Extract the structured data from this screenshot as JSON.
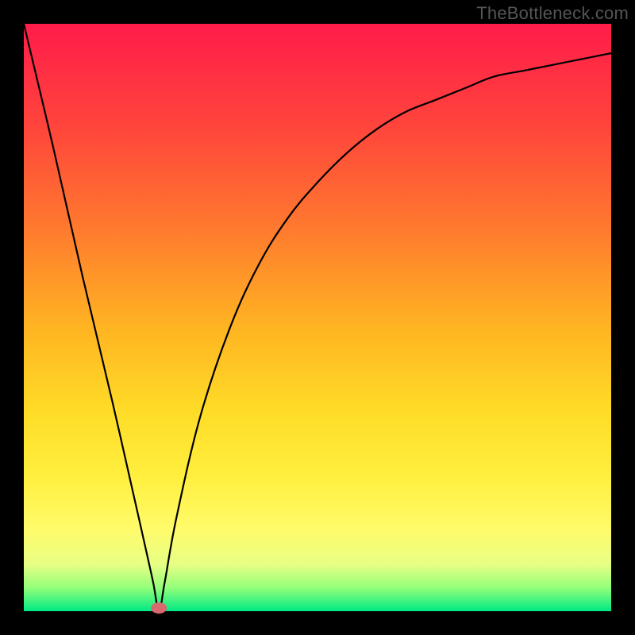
{
  "attribution": "TheBottleneck.com",
  "colors": {
    "frame": "#000000",
    "curve": "#000000",
    "marker": "#d9686f",
    "gradient_top": "#ff1c4a",
    "gradient_bottom": "#00e985"
  },
  "chart_data": {
    "type": "line",
    "title": "",
    "xlabel": "",
    "ylabel": "",
    "xlim": [
      0,
      100
    ],
    "ylim": [
      0,
      100
    ],
    "notes": "Bottleneck-style V curve. x is hardware capability (arbitrary axis, 0-100), y is mismatch/bottleneck percentage (0 = perfectly balanced, 100 = max bottleneck). Minimum near x≈23. Left branch is near-linear steep descent; right branch is a concave recovery curve saturating toward ~95 at x=100. No axis ticks or labels are rendered in the original image.",
    "x": [
      0,
      5,
      10,
      15,
      20,
      22,
      23,
      24,
      26,
      30,
      35,
      40,
      45,
      50,
      55,
      60,
      65,
      70,
      75,
      80,
      85,
      90,
      95,
      100
    ],
    "values": [
      100,
      79,
      57,
      36,
      14,
      5,
      0,
      5,
      16,
      33,
      48,
      59,
      67,
      73,
      78,
      82,
      85,
      87,
      89,
      91,
      92,
      93,
      94,
      95
    ],
    "marker": {
      "x": 23,
      "y": 0
    }
  }
}
